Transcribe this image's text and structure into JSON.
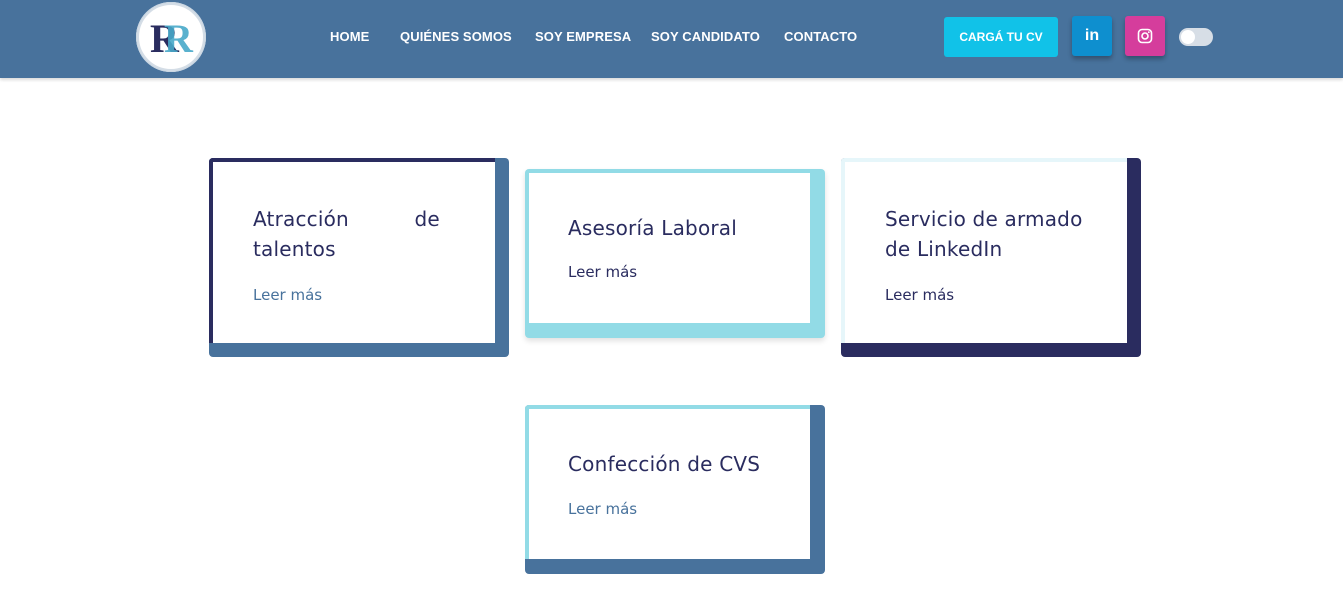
{
  "header": {
    "logo_text": "RR",
    "nav": [
      {
        "label": "HOME"
      },
      {
        "label": "QUIÉNES SOMOS"
      },
      {
        "label": "SOY EMPRESA"
      },
      {
        "label": "SOY CANDIDATO"
      },
      {
        "label": "CONTACTO"
      }
    ],
    "cta_label": "CARGÁ TU CV",
    "linkedin_glyph": "in",
    "colors": {
      "navbar": "#48729c",
      "cta": "#11c2e8",
      "linkedin": "#0e8fcf",
      "instagram": "#d53d9c"
    }
  },
  "services": [
    {
      "title_line1": "Atracción          de",
      "title_line2": "talentos",
      "link": "Leer más"
    },
    {
      "title_line1": "Asesoría Laboral",
      "title_line2": "",
      "link": "Leer más"
    },
    {
      "title_line1": "Servicio de armado",
      "title_line2": "de LinkedIn",
      "link": "Leer más"
    },
    {
      "title_line1": "Confección de CVS",
      "title_line2": "",
      "link": "Leer más"
    }
  ],
  "palette": {
    "navy": "#2a2c5f",
    "steel_blue": "#48729c",
    "light_cyan": "#92dbe6",
    "pale_cyan": "#e6f6fa"
  }
}
